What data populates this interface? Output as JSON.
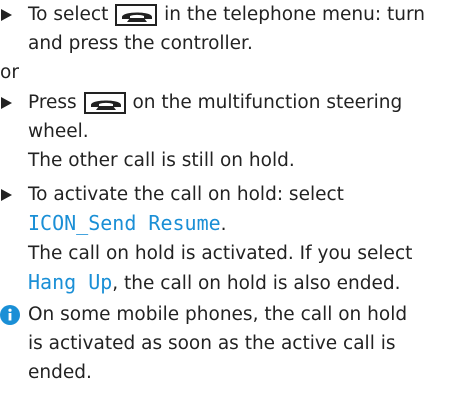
{
  "step1": {
    "before_icon": "To select ",
    "after_icon": " in the telephone menu: turn",
    "line2": "and press the controller."
  },
  "or_text": "or",
  "step2": {
    "before_icon": "Press ",
    "after_icon": " on the multifunction steering",
    "line2": "wheel.",
    "result": "The other call is still on hold."
  },
  "step3": {
    "line1": "To activate the call on hold: select",
    "menu_item": "ICON_Send Resume",
    "menu_item_suffix": ".",
    "result_line1": "The call on hold is activated. If you select",
    "hangup": "Hang Up",
    "result_line2_suffix": ", the call on hold is also ended."
  },
  "note": {
    "line1": "On some mobile phones, the call on hold",
    "line2": "is activated as soon as the active call is",
    "line3": "ended."
  },
  "colors": {
    "text": "#222222",
    "accent": "#1a8fd6"
  },
  "icons": {
    "bullet": "arrow-bullet-icon",
    "phone_key": "phone-key-icon",
    "info": "info-icon"
  }
}
